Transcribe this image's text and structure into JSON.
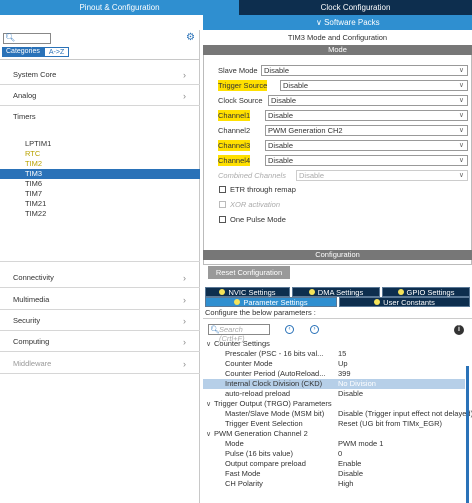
{
  "top_tabs": {
    "pinout": "Pinout & Configuration",
    "clock": "Clock Configuration"
  },
  "software_packs": "∨ Software Packs",
  "left": {
    "category_tabs": [
      "Categories",
      "A->Z"
    ],
    "categories": [
      {
        "label": "System Core",
        "chevron": "›"
      },
      {
        "label": "Analog",
        "chevron": "›"
      }
    ],
    "timers_label": "Timers",
    "timers": [
      {
        "label": "LPTIM1",
        "state": "normal"
      },
      {
        "label": "RTC",
        "state": "warn"
      },
      {
        "label": "TIM2",
        "state": "warn"
      },
      {
        "label": "TIM3",
        "state": "selected"
      },
      {
        "label": "TIM6",
        "state": "normal"
      },
      {
        "label": "TIM7",
        "state": "normal"
      },
      {
        "label": "TIM21",
        "state": "normal"
      },
      {
        "label": "TIM22",
        "state": "normal"
      }
    ],
    "categories_after": [
      {
        "label": "Connectivity",
        "chevron": "›"
      },
      {
        "label": "Multimedia",
        "chevron": "›"
      },
      {
        "label": "Security",
        "chevron": "›"
      },
      {
        "label": "Computing",
        "chevron": "›"
      },
      {
        "label": "Middleware",
        "chevron": "›"
      }
    ]
  },
  "right": {
    "title": "TIM3 Mode and Configuration",
    "mode_header": "Mode",
    "mode_fields": [
      {
        "label": "Slave Mode",
        "value": "Disable",
        "highlight": false,
        "dim": false
      },
      {
        "label": "Trigger Source",
        "value": "Disable",
        "highlight": true,
        "dim": false
      },
      {
        "label": "Clock Source",
        "value": "Disable",
        "highlight": false,
        "dim": false
      },
      {
        "label": "Channel1",
        "value": "Disable",
        "highlight": true,
        "dim": false
      },
      {
        "label": "Channel2",
        "value": "PWM Generation CH2",
        "highlight": false,
        "dim": false
      },
      {
        "label": "Channel3",
        "value": "Disable",
        "highlight": true,
        "dim": false
      },
      {
        "label": "Channel4",
        "value": "Disable",
        "highlight": true,
        "dim": false
      },
      {
        "label": "Combined Channels",
        "value": "Disable",
        "highlight": false,
        "dim": true
      }
    ],
    "checkboxes": [
      {
        "label": "ETR through remap",
        "dim": false
      },
      {
        "label": "XOR activation",
        "dim": true
      },
      {
        "label": "One Pulse Mode",
        "dim": false
      }
    ],
    "config_header": "Configuration",
    "reset_button": "Reset Configuration",
    "settings_tabs": {
      "nvic": "NVIC Settings",
      "dma": "DMA Settings",
      "gpio": "GPIO Settings",
      "parameter": "Parameter Settings",
      "user_constants": "User Constants"
    },
    "configure_text": "Configure the below parameters :",
    "search_placeholder": "Search (Crtl+F)",
    "nav_prev": "‹",
    "nav_next": "›",
    "info": "i",
    "groups": [
      {
        "name": "Counter Settings",
        "params": [
          {
            "name": "Prescaler (PSC - 16 bits val...",
            "value": "15",
            "selected": false
          },
          {
            "name": "Counter Mode",
            "value": "Up",
            "selected": false
          },
          {
            "name": "Counter Period (AutoReload...",
            "value": "399",
            "selected": false
          },
          {
            "name": "Internal Clock Division (CKD)",
            "value": "No Division",
            "selected": true
          },
          {
            "name": "auto-reload preload",
            "value": "Disable",
            "selected": false
          }
        ]
      },
      {
        "name": "Trigger Output (TRGO) Parameters",
        "params": [
          {
            "name": "Master/Slave Mode (MSM bit)",
            "value": "Disable (Trigger input effect not delayed)",
            "selected": false
          },
          {
            "name": "Trigger Event Selection",
            "value": "Reset (UG bit from TIMx_EGR)",
            "selected": false
          }
        ]
      },
      {
        "name": "PWM Generation Channel 2",
        "params": [
          {
            "name": "Mode",
            "value": "PWM mode 1",
            "selected": false
          },
          {
            "name": "Pulse (16 bits value)",
            "value": "0",
            "selected": false
          },
          {
            "name": "Output compare preload",
            "value": "Enable",
            "selected": false
          },
          {
            "name": "Fast Mode",
            "value": "Disable",
            "selected": false
          },
          {
            "name": "CH Polarity",
            "value": "High",
            "selected": false
          }
        ]
      }
    ]
  }
}
